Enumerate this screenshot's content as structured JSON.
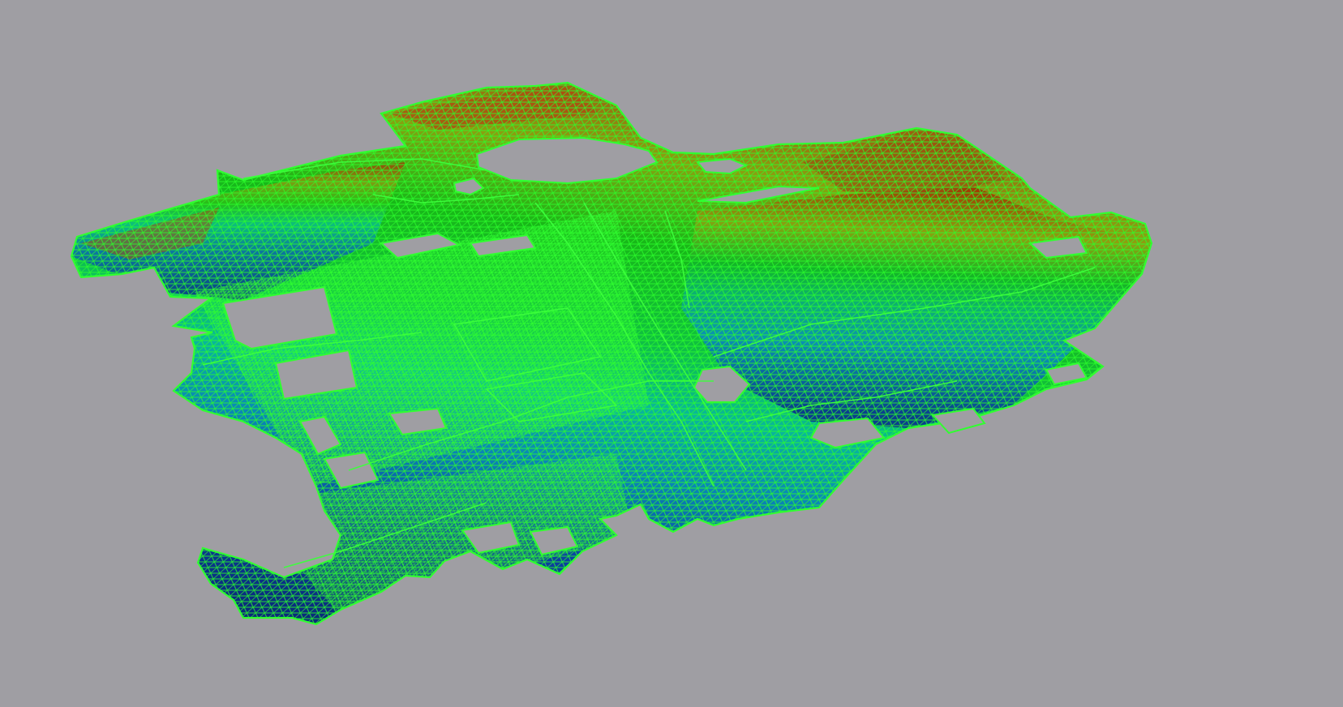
{
  "viewport": {
    "background_color": "#9f9ea3",
    "wireframe_color": "#22ff22",
    "colormap": [
      "#0a2a8a",
      "#0b4fa6",
      "#0aa0b8",
      "#10c060",
      "#20d020",
      "#7bb010",
      "#a86010",
      "#a02000"
    ],
    "hole_color": "#9f9ea3"
  }
}
